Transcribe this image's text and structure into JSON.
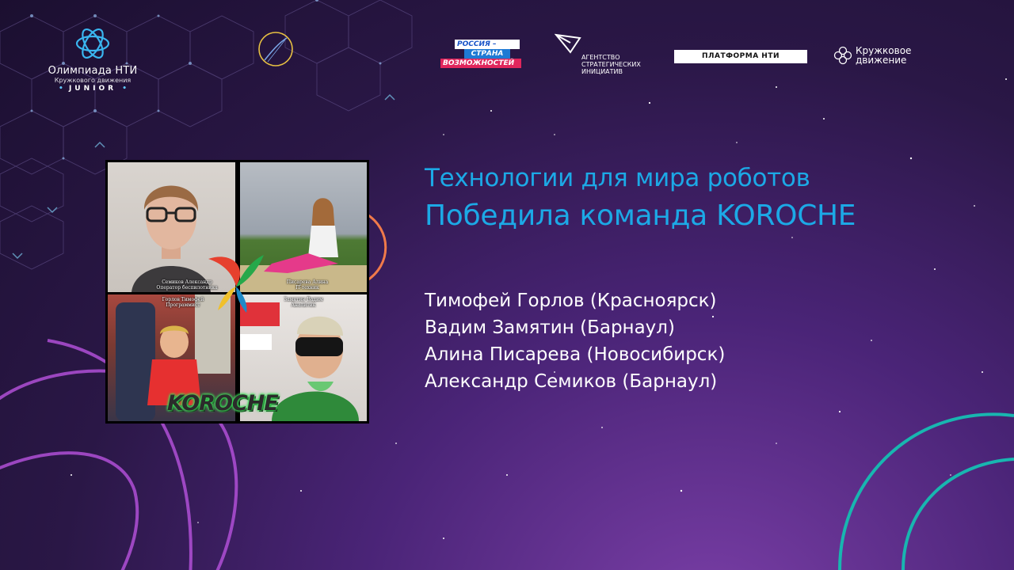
{
  "header": {
    "olympiad_logo": {
      "title": "Олимпиада НТИ",
      "subtitle": "Кружкового движения",
      "level": "JUNIOR"
    },
    "russia_logo": {
      "line1": "РОССИЯ –",
      "line2": "СТРАНА",
      "line3": "ВОЗМОЖНОСТЕЙ"
    },
    "asi_logo": {
      "line1": "АГЕНТСТВО",
      "line2": "СТРАТЕГИЧЕСКИХ",
      "line3": "ИНИЦИАТИВ"
    },
    "platform_logo": "ПЛАТФОРМА НТИ",
    "kruzhok_logo": {
      "line1": "Кружковое",
      "line2": "движение"
    }
  },
  "collage": {
    "captions": [
      {
        "name": "Семиков Александр",
        "role": "Оператор беспилотника"
      },
      {
        "name": "Писарева Алина",
        "role": "IT-техник"
      },
      {
        "name": "Горлов Тимофей",
        "role": "Программист"
      },
      {
        "name": "Замятин Вадим",
        "role": "Аналитик"
      }
    ],
    "team_logo": "KOROCHE"
  },
  "content": {
    "title": "Технологии для мира роботов",
    "subtitle": "Победила команда KOROCHE",
    "members": [
      "Тимофей Горлов (Красноярск)",
      "Вадим Замятин (Барнаул)",
      "Алина Писарева (Новосибирск)",
      "Александр Семиков (Барнаул)"
    ]
  },
  "colors": {
    "accent": "#1ca9e6",
    "teal_ring": "#18b6b0",
    "purple_ring": "#b04fd6",
    "orange_ring": "#f07a4a"
  }
}
